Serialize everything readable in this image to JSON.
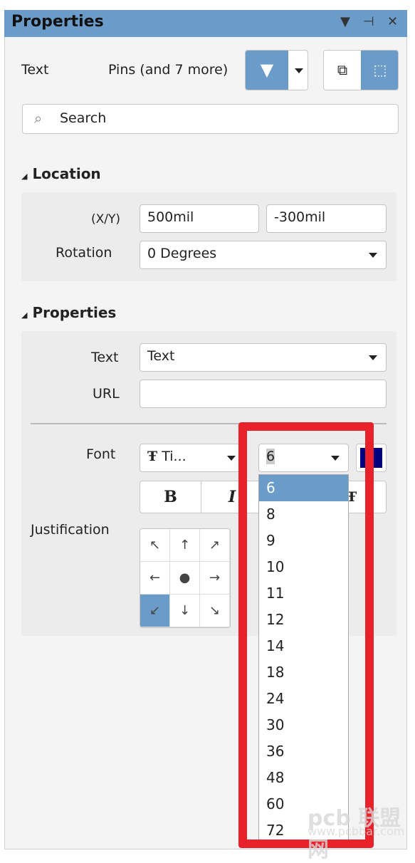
{
  "header": {
    "title": "Properties"
  },
  "filter": {
    "object_type": "Text",
    "selection": "Pins (and 7 more)"
  },
  "search": {
    "placeholder": "Search"
  },
  "location": {
    "title": "Location",
    "xy_label": "(X/Y)",
    "x": "500mil",
    "y": "-300mil",
    "rotation_label": "Rotation",
    "rotation": "0 Degrees"
  },
  "properties": {
    "title": "Properties",
    "text_label": "Text",
    "text_value": "Text",
    "url_label": "URL",
    "url_value": "",
    "font_label": "Font",
    "font_name": "Ti...",
    "font_size": "6",
    "font_color": "#000080",
    "bold": "B",
    "italic": "I",
    "justification_label": "Justification",
    "justification_selected": "bottom-left"
  },
  "font_size_options": [
    "6",
    "8",
    "9",
    "10",
    "11",
    "12",
    "14",
    "18",
    "24",
    "30",
    "36",
    "48",
    "60",
    "72"
  ],
  "selected_font_size": "6",
  "accent_color": "#6a9bc9",
  "highlight_color": "#e8212b",
  "watermark": {
    "logo": "pcb 联盟网",
    "url": "www.pcbbar.com"
  }
}
